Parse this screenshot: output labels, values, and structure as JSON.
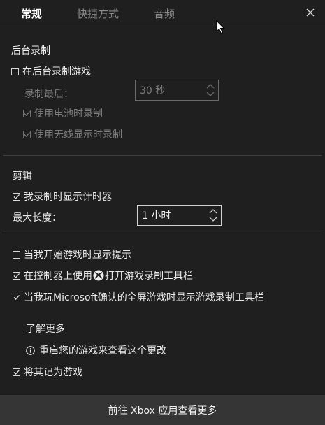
{
  "tabs": {
    "general": "常规",
    "shortcuts": "快捷方式",
    "audio": "音频"
  },
  "background_recording": {
    "title": "后台录制",
    "record_in_background": "在后台录制游戏",
    "record_last_label": "录制最后：",
    "record_last_value": "30 秒",
    "record_on_battery": "使用电池时录制",
    "record_wireless_display": "使用无线显示时录制"
  },
  "clips": {
    "title": "剪辑",
    "show_timer": "我录制时显示计时器",
    "max_length_label": "最大长度：",
    "max_length_value": "1 小时"
  },
  "options": {
    "show_tips": "当我开始游戏时显示提示",
    "open_with_controller_prefix": "在控制器上使用",
    "open_with_controller_suffix": "打开游戏录制工具栏",
    "show_fullscreen_verified": "当我玩Microsoft确认的全屏游戏时显示游戏录制工具栏"
  },
  "learn_more": "了解更多",
  "info_text": "重启您的游戏来查看这个更改",
  "remember_as_game": "将其记为游戏",
  "footer_button": "前往 Xbox 应用查看更多",
  "checkbox_states": {
    "record_in_background": false,
    "record_on_battery": true,
    "record_wireless_display": true,
    "show_timer": true,
    "show_tips": false,
    "open_with_controller": true,
    "show_fullscreen_verified": true,
    "remember_as_game": true
  }
}
